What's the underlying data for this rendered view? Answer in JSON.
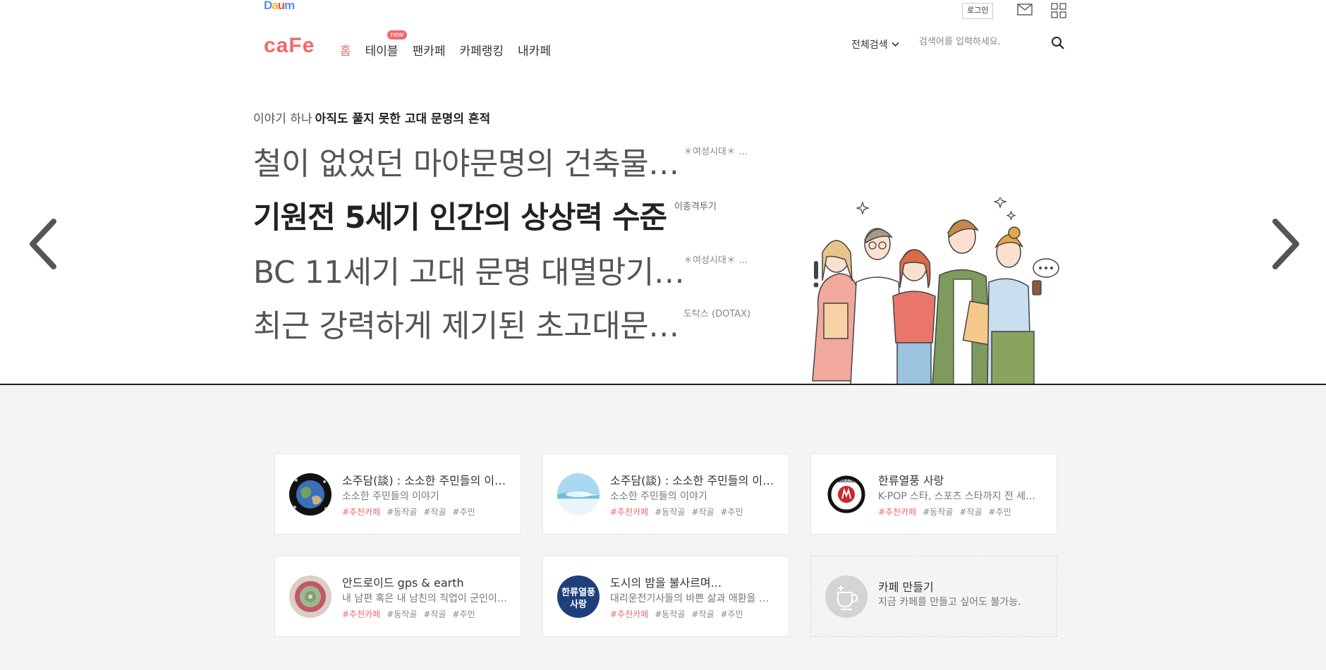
{
  "header": {
    "daum_logo": [
      "D",
      "a",
      "u",
      "m"
    ],
    "daum_colors": [
      "#5b8def",
      "#f2b92a",
      "#e0544f",
      "#5b8def"
    ],
    "login": "로그인",
    "cafe_logo": "caFe",
    "nav": [
      {
        "label": "홈",
        "active": true
      },
      {
        "label": "테이블",
        "badge": "new"
      },
      {
        "label": "팬카페"
      },
      {
        "label": "카페랭킹"
      },
      {
        "label": "내카페"
      }
    ],
    "search": {
      "scope": "전체검색",
      "placeholder": "검색어를 입력하세요."
    }
  },
  "hero": {
    "kicker_prefix": "이야기 하나",
    "kicker_title": "아직도 풀지 못한 고대 문명의 흔적",
    "headlines": [
      {
        "text": "철이 없었던 마야문명의 건축물…",
        "source": "＊여성시대＊ …"
      },
      {
        "text": "기원전 5세기 인간의 상상력 수준",
        "source": "이종격투기"
      },
      {
        "text": "BC 11세기 고대 문명 대멸망기…",
        "source": "＊여성시대＊ …"
      },
      {
        "text": "최근 강력하게 제기된 초고대문…",
        "source": "도탁스 (DOTAX)"
      }
    ]
  },
  "cards": [
    {
      "title": "소주담(談) : 소소한 주민들의 이…",
      "desc": "소소한 주민들의 이야기",
      "tags": [
        "#추천카페",
        "#동작골",
        "#작골",
        "#주민"
      ]
    },
    {
      "title": "소주담(談) : 소소한 주민들의 이…",
      "desc": "소소한 주민들의 이야기",
      "tags": [
        "#추천카페",
        "#동작골",
        "#작골",
        "#주민"
      ]
    },
    {
      "title": "한류열풍 사랑",
      "desc": "K-POP 스타, 스포츠 스타까지 전 세…",
      "tags": [
        "#추천카페",
        "#동작골",
        "#작골",
        "#주민"
      ]
    },
    {
      "title": "안드로이드 gps & earth",
      "desc": "내 남편 혹은 내 남친의 직업이 군인이…",
      "tags": [
        "#추천카페",
        "#동작골",
        "#작골",
        "#주민"
      ]
    },
    {
      "title": "도시의 밤을 불사르며...",
      "desc": "대리운전기사들의 바쁜 삶과 애환을 …",
      "tags": [
        "#추천카페",
        "#동작골",
        "#작골",
        "#주민"
      ]
    }
  ],
  "make_cafe": {
    "title": "카페 만들기",
    "desc": "지금 카페를 만들고 싶어도 불가능."
  },
  "thumb_text": {
    "hanryu": "MIRAGE",
    "city": "한류열풍 사랑"
  },
  "colors": {
    "accent": "#f06a6a",
    "text": "#333333",
    "bg_lower": "#f4f4f4"
  }
}
